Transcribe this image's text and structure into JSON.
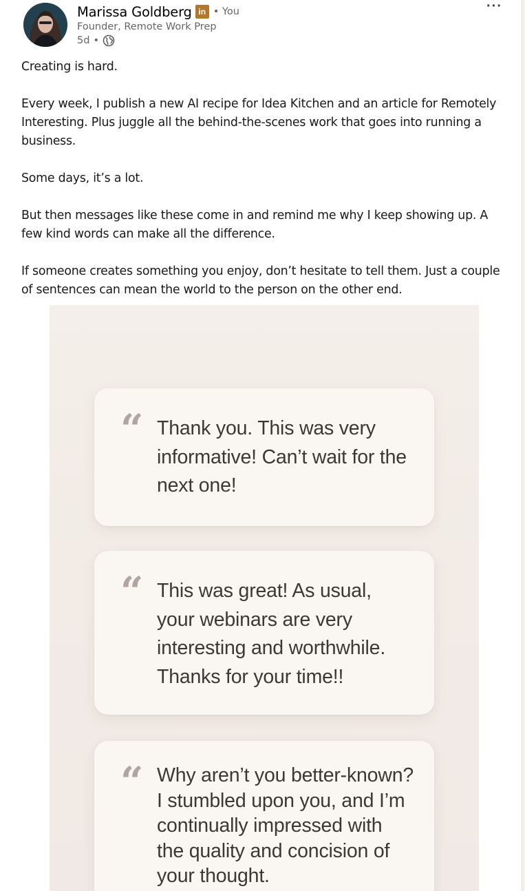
{
  "author": {
    "name": "Marissa Goldberg",
    "badge": "in",
    "relation": "• You",
    "headline": "Founder, Remote Work Prep",
    "time": "5d",
    "separator": "•",
    "visibility_icon": "globe-icon"
  },
  "menu": {
    "more_label": "···"
  },
  "post": {
    "paragraphs": [
      "Creating is hard.",
      "Every week, I publish a new AI recipe for Idea Kitchen and an article for Remotely Interesting. Plus juggle all the behind-the-scenes work that goes into running a business.",
      "Some days, it’s a lot.",
      "But then messages like these come in and remind me why I keep showing up. A few kind words can make all the difference.",
      "If someone creates something you enjoy, don’t hesitate to tell them. Just a couple of sentences can mean the world to the person on the other end."
    ]
  },
  "image": {
    "quote_glyph": "“",
    "quotes": [
      "Thank you. This was very informative! Can’t wait for the next one!",
      "This was great! As usual, your webinars are very interesting and worthwhile. Thanks for your time!!",
      "Why aren’t you better-known? I stumbled upon you, and I’m continually impressed with the quality and concision of your thought."
    ]
  },
  "colors": {
    "badge": "#b4762a",
    "muted_text": "#666666",
    "image_background": "#f3eee9",
    "card_background": "#faf6f2"
  }
}
